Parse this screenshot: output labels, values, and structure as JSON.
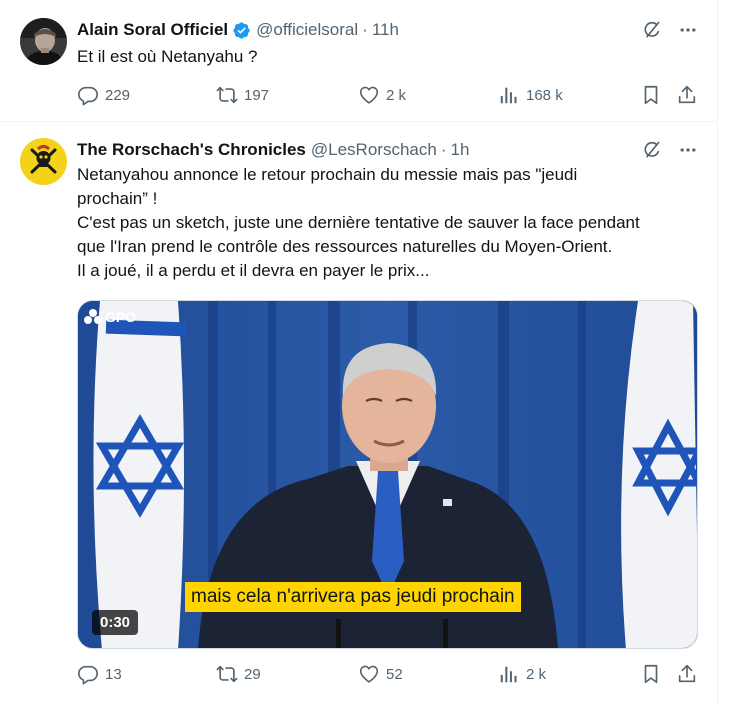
{
  "icons": {
    "reply": "reply-icon",
    "retweet": "retweet-icon",
    "like": "heart-icon",
    "views": "views-icon",
    "bookmark": "bookmark-icon",
    "share": "share-icon",
    "grok": "grok-icon",
    "more": "more-icon",
    "verified": "verified-badge-icon"
  },
  "colors": {
    "verified": "#1d9bf0",
    "secondary_text": "#536471",
    "caption_bg": "#ffd400"
  },
  "tweets": [
    {
      "author_name": "Alain Soral Officiel",
      "verified": true,
      "handle": "@officielsoral",
      "separator": "·",
      "time": "11h",
      "text": "Et il est où Netanyahu ?",
      "replies": "229",
      "retweets": "197",
      "likes": "2 k",
      "views": "168 k"
    },
    {
      "author_name": "The Rorschach's Chronicles",
      "verified": false,
      "handle": "@LesRorschach",
      "separator": "·",
      "time": "1h",
      "text_lines": [
        "Netanyahou annonce le retour prochain du messie mais pas \"jeudi",
        "prochain” !",
        "C'est pas un sketch, juste une dernière tentative de sauver la face pendant",
        "que l'Iran prend le contrôle des ressources naturelles du Moyen-Orient.",
        "Il a joué, il a perdu et il devra en payer le prix..."
      ],
      "media": {
        "logo_text": "GPO",
        "caption": "mais cela n'arrivera pas jeudi prochain",
        "duration": "0:30"
      },
      "replies": "13",
      "retweets": "29",
      "likes": "52",
      "views": "2 k"
    }
  ]
}
